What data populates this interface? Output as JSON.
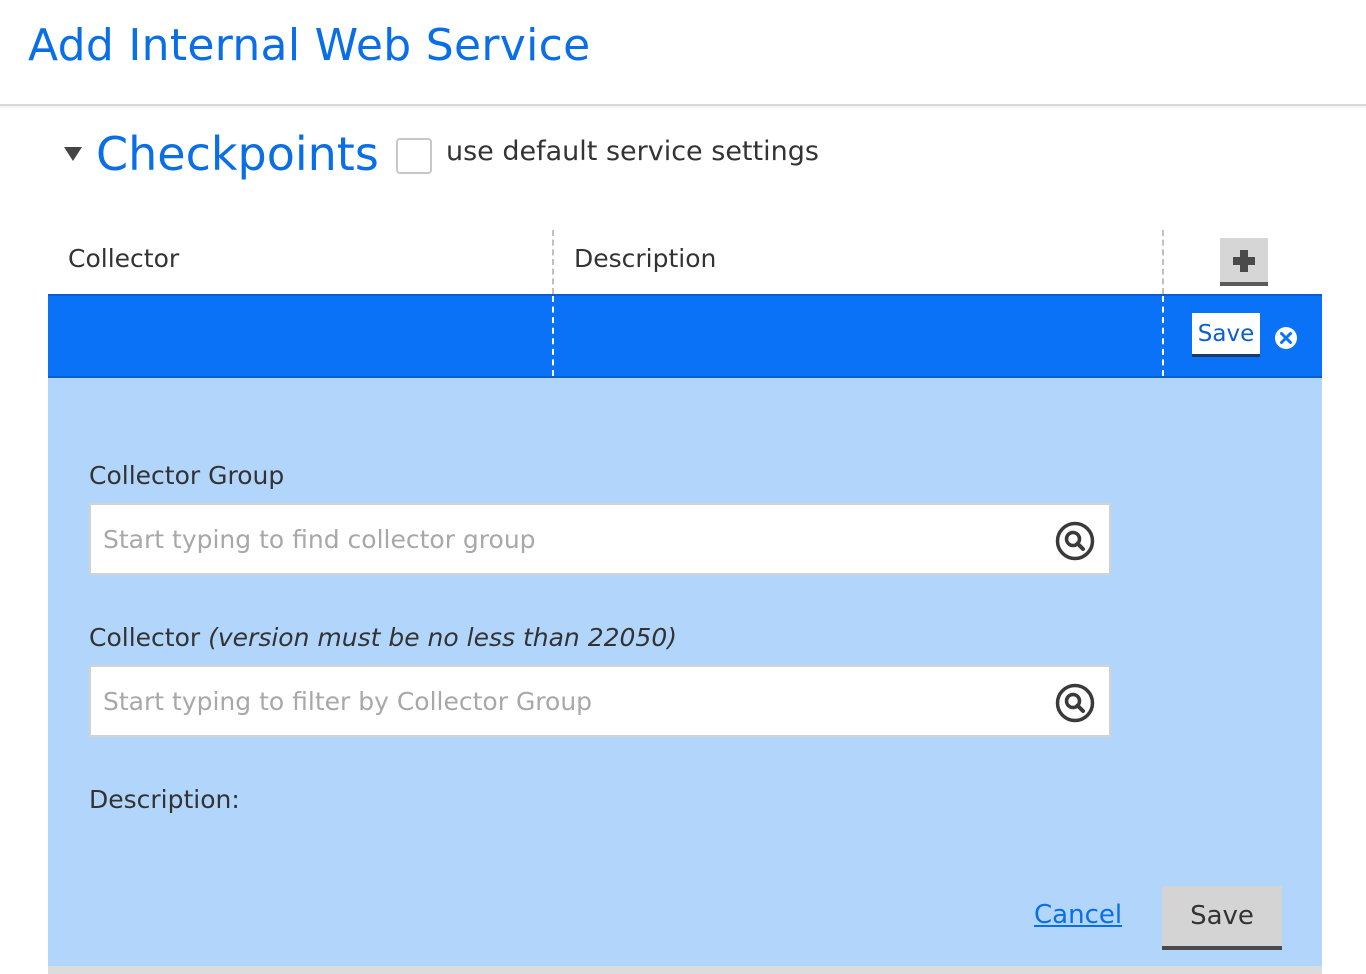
{
  "header": {
    "title": "Add Internal Web Service"
  },
  "section": {
    "title": "Checkpoints",
    "default_settings_label": "use default service settings",
    "default_settings_checked": false
  },
  "table": {
    "columns": [
      "Collector",
      "Description"
    ],
    "row_actions": {
      "save_label": "Save"
    }
  },
  "form": {
    "collector_group": {
      "label": "Collector Group",
      "value": "",
      "placeholder": "Start typing to find collector group"
    },
    "collector": {
      "label": "Collector",
      "note": "(version must be no less than 22050)",
      "value": "",
      "placeholder": "Start typing to filter by Collector Group"
    },
    "description": {
      "label": "Description:"
    },
    "cancel_label": "Cancel",
    "save_label": "Save"
  },
  "colors": {
    "accent": "#0a6fe6",
    "selected_row": "#0a72f6",
    "panel_bg": "#b2d6fb"
  },
  "icons": {
    "toggle": "triangle-down-icon",
    "add": "plus-icon",
    "close": "close-circle-icon",
    "search": "magnifier-icon"
  }
}
